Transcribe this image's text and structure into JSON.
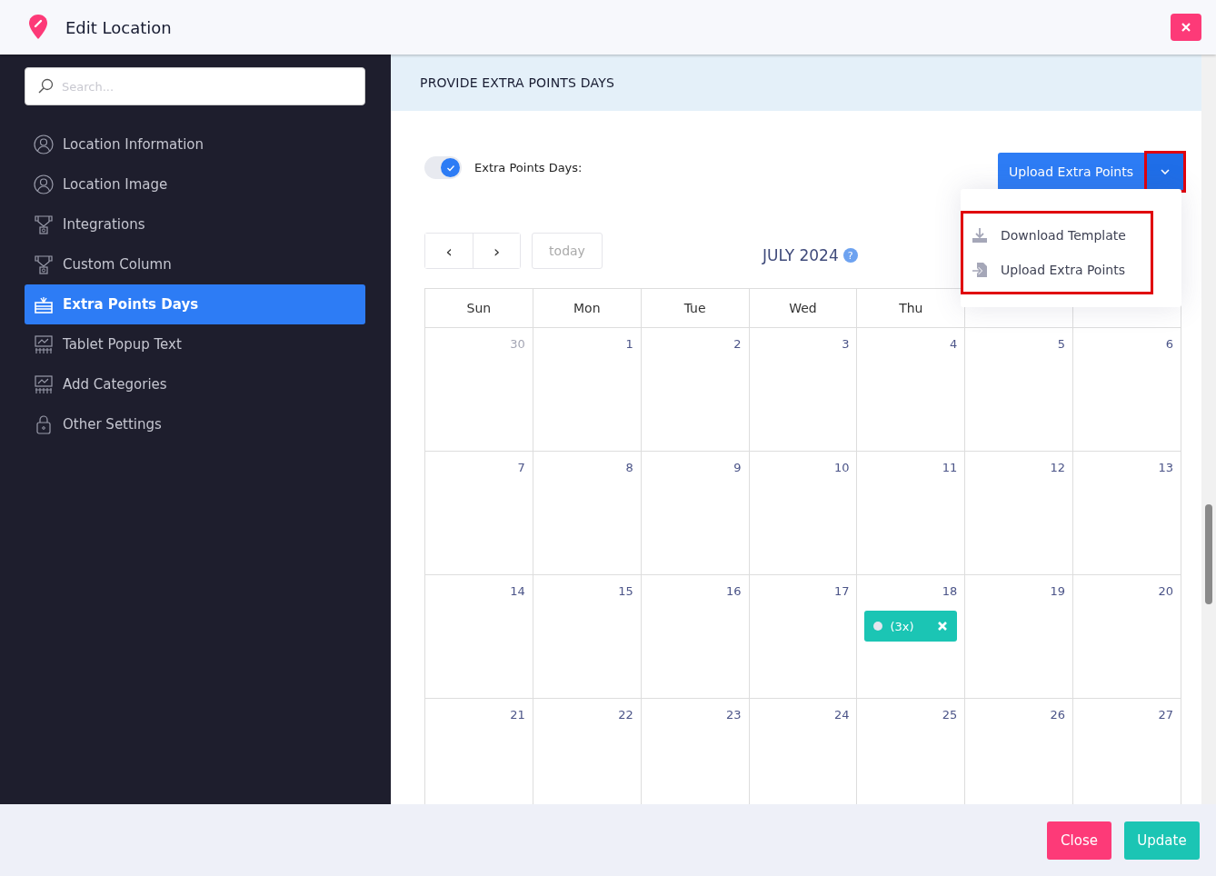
{
  "window": {
    "title": "Edit Location"
  },
  "sidebar": {
    "search": {
      "placeholder": "Search..."
    },
    "items": [
      {
        "label": "Location Information",
        "selected": false
      },
      {
        "label": "Location Image",
        "selected": false
      },
      {
        "label": "Integrations",
        "selected": false
      },
      {
        "label": "Custom Column",
        "selected": false
      },
      {
        "label": "Extra Points Days",
        "selected": true
      },
      {
        "label": "Tablet Popup Text",
        "selected": false
      },
      {
        "label": "Add Categories",
        "selected": false
      },
      {
        "label": "Other Settings",
        "selected": false
      }
    ]
  },
  "section": {
    "title": "PROVIDE EXTRA POINTS DAYS"
  },
  "toggle": {
    "label": "Extra Points Days:",
    "on": true
  },
  "upload_button": {
    "label": "Upload Extra Points",
    "highlighted": true
  },
  "dropdown": {
    "highlighted": true,
    "items": [
      {
        "label": "Download Template"
      },
      {
        "label": "Upload Extra Points"
      }
    ]
  },
  "calendar": {
    "prev": "‹",
    "next": "›",
    "today": "today",
    "title": "JULY 2024",
    "help": "?",
    "columns": [
      "Sun",
      "Mon",
      "Tue",
      "Wed",
      "Thu"
    ],
    "weeks": [
      [
        {
          "day": "30",
          "other_month": true
        },
        {
          "day": "1",
          "other_month": false
        },
        {
          "day": "2",
          "other_month": false
        },
        {
          "day": "3",
          "other_month": false
        },
        {
          "day": "4",
          "other_month": false
        },
        {
          "day": "5",
          "other_month": false
        },
        {
          "day": "6",
          "other_month": false
        }
      ],
      [
        {
          "day": "7",
          "other_month": false
        },
        {
          "day": "8",
          "other_month": false
        },
        {
          "day": "9",
          "other_month": false
        },
        {
          "day": "10",
          "other_month": false
        },
        {
          "day": "11",
          "other_month": false
        },
        {
          "day": "12",
          "other_month": false
        },
        {
          "day": "13",
          "other_month": false
        }
      ],
      [
        {
          "day": "14",
          "other_month": false
        },
        {
          "day": "15",
          "other_month": false
        },
        {
          "day": "16",
          "other_month": false
        },
        {
          "day": "17",
          "other_month": false
        },
        {
          "day": "18",
          "other_month": false,
          "events": [
            {
              "label": "(3x)"
            }
          ]
        },
        {
          "day": "19",
          "other_month": false
        },
        {
          "day": "20",
          "other_month": false
        }
      ],
      [
        {
          "day": "21",
          "other_month": false
        },
        {
          "day": "22",
          "other_month": false
        },
        {
          "day": "23",
          "other_month": false
        },
        {
          "day": "24",
          "other_month": false
        },
        {
          "day": "25",
          "other_month": false
        },
        {
          "day": "26",
          "other_month": false
        },
        {
          "day": "27",
          "other_month": false
        }
      ]
    ]
  },
  "footer": {
    "buttons": [
      {
        "label": "Close",
        "kind": "danger"
      },
      {
        "label": "Update",
        "kind": "success"
      }
    ]
  }
}
